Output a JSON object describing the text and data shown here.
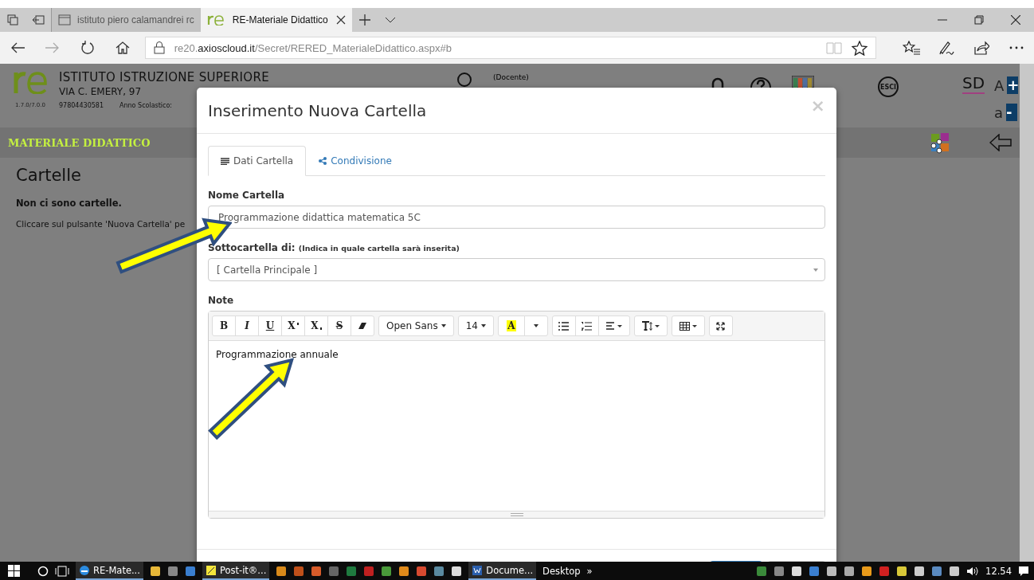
{
  "browser": {
    "tabs": [
      {
        "title": "istituto piero calamandrei rc",
        "selected": false
      },
      {
        "title": "RE-Materiale Didattico",
        "selected": true
      }
    ],
    "url": "re20.**axioscloud.it**/Secret/RERED_MaterialeDidattico.aspx#b"
  },
  "page": {
    "school": "ISTITUTO ISTRUZIONE SUPERIORE",
    "address": "VIA C. EMERY, 97",
    "version": "1.7.0/7.0.0",
    "code": "97804430581",
    "year_label": "Anno Scolastico:",
    "role": "(Docente)",
    "logout": "ESCI",
    "logo_sd": "SD",
    "font_up": {
      "letter": "A",
      "sign": "+"
    },
    "font_down": {
      "letter": "a",
      "sign": "-"
    },
    "section": "MATERIALE DIDATTICO",
    "heading": "Cartelle",
    "empty": "Non ci sono cartelle.",
    "hint": "Cliccare sul pulsante 'Nuova Cartella' pe"
  },
  "modal": {
    "title": "Inserimento Nuova Cartella",
    "close": "×",
    "tabs": [
      {
        "label": "Dati Cartella",
        "kind": "lines",
        "selected": true
      },
      {
        "label": "Condivisione",
        "kind": "share",
        "selected": false
      }
    ],
    "name_label": "Nome Cartella",
    "name_value": "Programmazione didattica matematica 5C",
    "parent_label": "Sottocartella di:",
    "parent_hint": "(Indica in quale cartella sarà inserita)",
    "parent_value": "[ Cartella Principale ]",
    "note_label": "Note",
    "toolbar": [
      [
        {
          "kind": "bold",
          "label": "B"
        },
        {
          "kind": "italic",
          "label": "I"
        },
        {
          "kind": "underline",
          "label": "U"
        },
        {
          "kind": "sup",
          "label": "X"
        },
        {
          "kind": "sub",
          "label": "X"
        },
        {
          "kind": "strike",
          "label": "S"
        },
        {
          "kind": "eraser"
        }
      ],
      [
        {
          "kind": "dropdown",
          "label": "Open Sans"
        }
      ],
      [
        {
          "kind": "dropdown",
          "label": "14"
        }
      ],
      [
        {
          "kind": "highlight",
          "label": "A"
        },
        {
          "kind": "caret"
        }
      ],
      [
        {
          "kind": "ul"
        },
        {
          "kind": "ol"
        },
        {
          "kind": "align"
        }
      ],
      [
        {
          "kind": "height"
        }
      ],
      [
        {
          "kind": "table"
        }
      ],
      [
        {
          "kind": "fullscreen"
        }
      ]
    ],
    "note_value": "Programmazione annuale"
  },
  "annotations": [
    {
      "kind": "arrow"
    },
    {
      "kind": "arrow"
    }
  ],
  "taskbar": {
    "apps": [
      {
        "kind": "edge",
        "label": "RE-Mate..."
      },
      {
        "kind": "postit",
        "label": "Post-it®..."
      },
      {
        "kind": "word",
        "label": "Docume..."
      }
    ],
    "desktop": "Desktop",
    "more": "»",
    "time": "12.54"
  }
}
